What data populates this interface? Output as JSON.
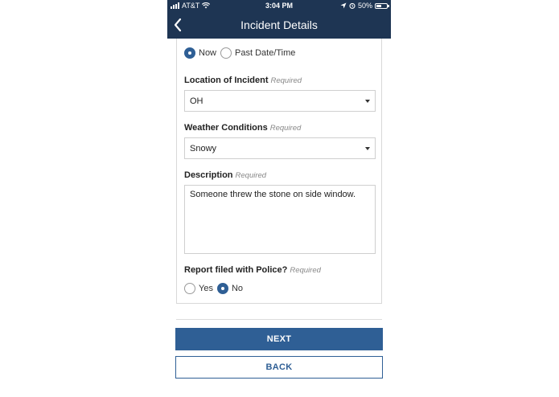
{
  "status_bar": {
    "carrier": "AT&T",
    "time": "3:04 PM",
    "battery": "50%",
    "battery_level": 0.5
  },
  "nav": {
    "title": "Incident Details"
  },
  "time_of_incident": {
    "options": [
      {
        "label": "Now",
        "selected": true
      },
      {
        "label": "Past Date/Time",
        "selected": false
      }
    ]
  },
  "location": {
    "label": "Location of Incident",
    "required": "Required",
    "value": "OH"
  },
  "weather": {
    "label": "Weather Conditions",
    "required": "Required",
    "value": "Snowy"
  },
  "description": {
    "label": "Description",
    "required": "Required",
    "value": "Someone threw the stone on side window."
  },
  "police_report": {
    "label": "Report filed with Police?",
    "required": "Required",
    "options": [
      {
        "label": "Yes",
        "selected": false
      },
      {
        "label": "No",
        "selected": true
      }
    ]
  },
  "buttons": {
    "next": "NEXT",
    "back": "BACK"
  },
  "colors": {
    "header": "#1e3553",
    "accent": "#2f5f95"
  }
}
